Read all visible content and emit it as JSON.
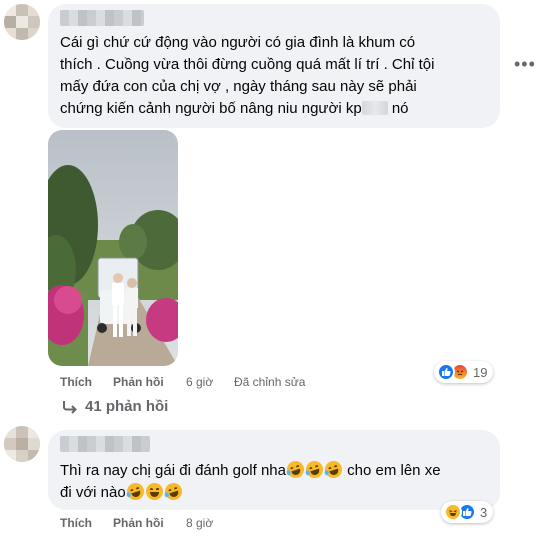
{
  "comment1": {
    "lines": [
      "Cái gì chứ cứ động vào người có gia đình là khum có",
      "thích . Cuồng vừa thôi đừng cuồng quá mất lí trí . Chỉ tội",
      "mấy đứa con của chị vợ , ngày tháng sau này sẽ phải",
      "chứng kiến cảnh người bố nâng niu người kp"
    ],
    "line4_tail": "nó",
    "more_icon": "more-horizontal-icon",
    "actions": {
      "like": "Thích",
      "reply": "Phản hồi",
      "time": "6 giờ",
      "edited": "Đã chỉnh sửa"
    },
    "reactions": {
      "icons": [
        "like-icon",
        "angry-icon"
      ],
      "count": "19"
    },
    "replies_label": "41 phản hồi"
  },
  "comment2": {
    "line1": "Thì ra nay chị gái đi đánh golf nha",
    "line1_tail": " cho em lên xe",
    "line2": "đi với nào",
    "actions": {
      "like": "Thích",
      "reply": "Phản hồi",
      "time": "8 giờ"
    },
    "reactions": {
      "icons": [
        "haha-icon",
        "like-icon"
      ],
      "count": "3"
    }
  },
  "colors": {
    "bubble": "#f0f2f5",
    "secondary_text": "#65676b",
    "like_blue": "#1877f2",
    "angry": "#e9710f"
  }
}
